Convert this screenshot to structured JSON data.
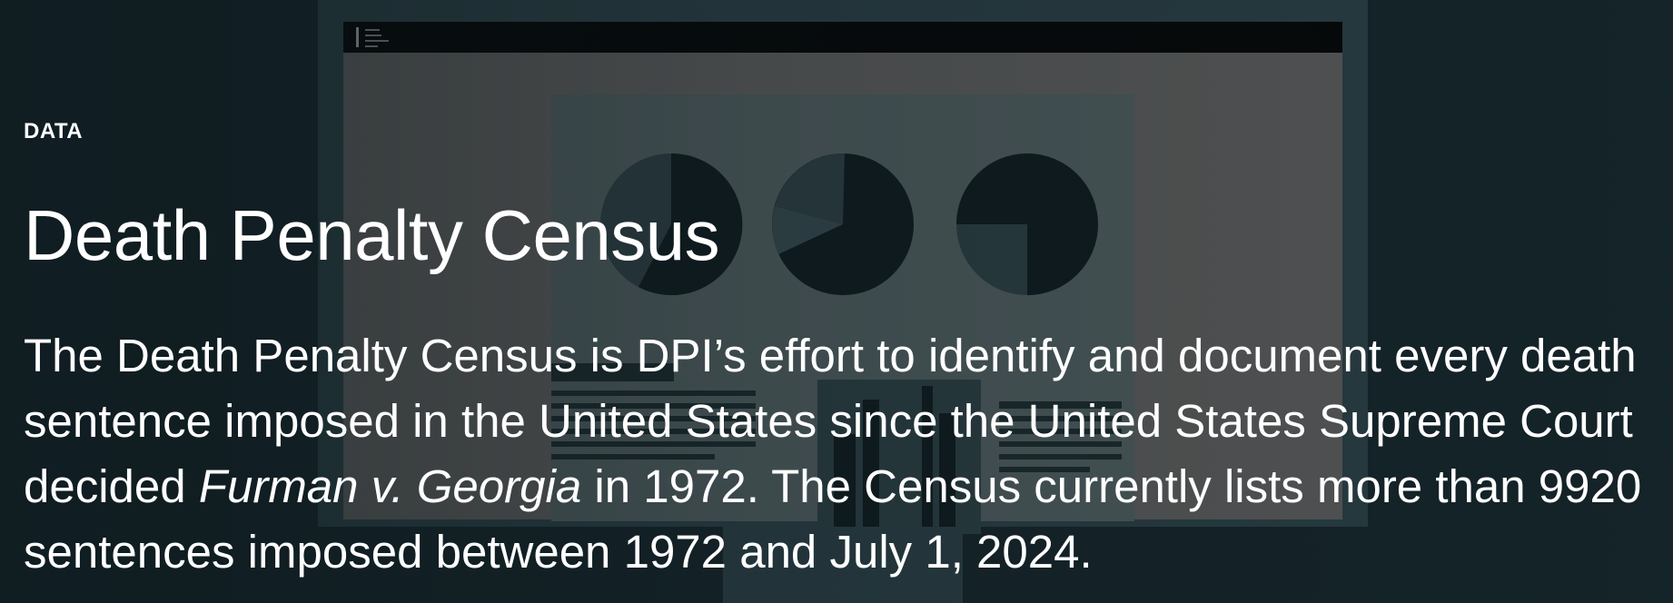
{
  "hero": {
    "eyebrow": "DATA",
    "title": "Death Penalty Census",
    "description": {
      "part1": "The Death Penalty Census is DPI’s effort to identify and document every death sentence imposed in the United States since the United States Supreme Court decided ",
      "case_name": "Furman v. Georgia",
      "part2": " in 1972. The Census currently lists more than 9920 sentences imposed between 1972 and July 1, 2024."
    }
  },
  "background": {
    "illustration": "monitor-with-pie-charts-illustration",
    "colors": {
      "base": "#16252a",
      "monitor_frame": "#2b3f46",
      "screen": "#5c5c5c",
      "panel": "#4f5c5e",
      "dark": "#0f1b1f",
      "accent": "#2e4349"
    }
  }
}
